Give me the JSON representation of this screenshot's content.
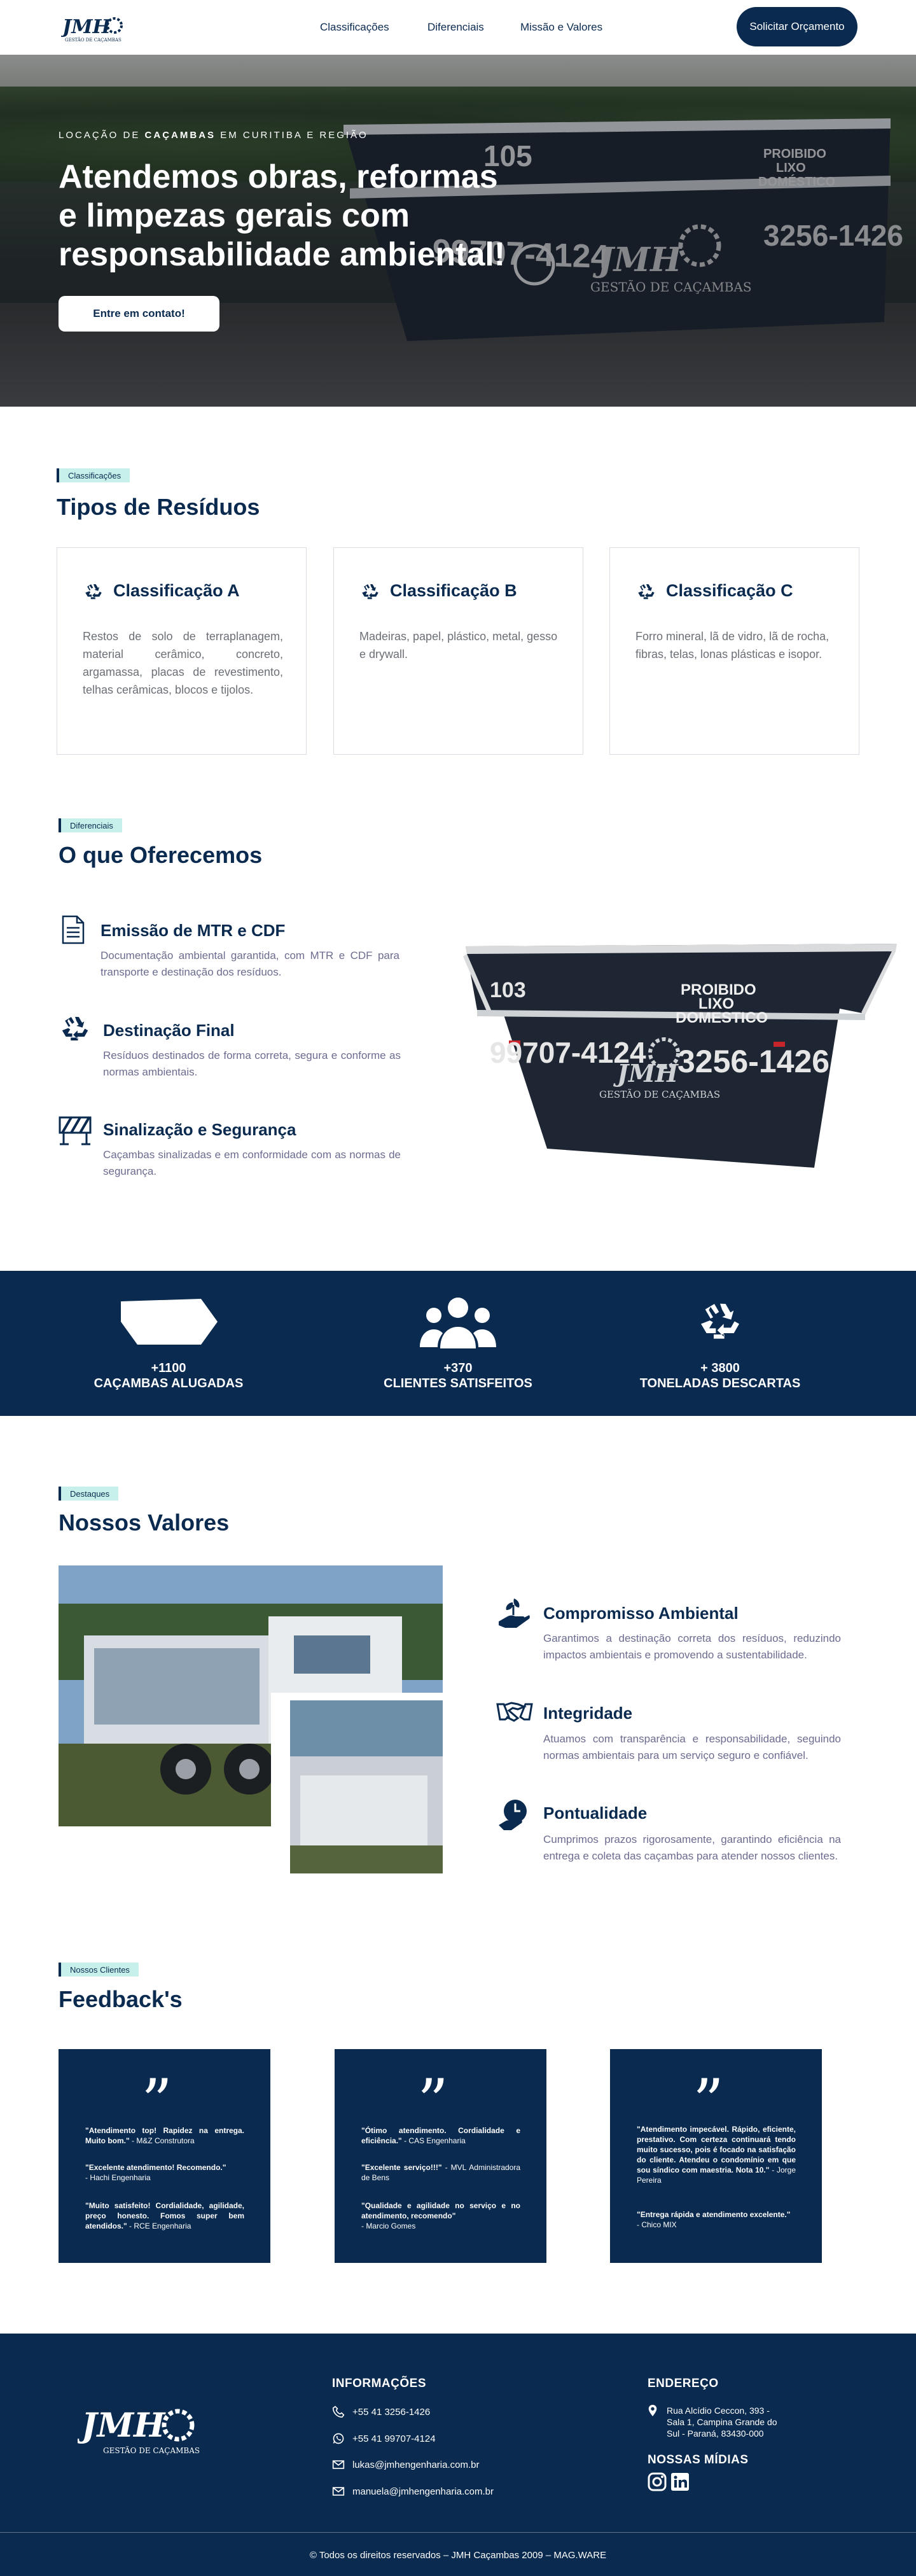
{
  "header": {
    "logo": "JMH",
    "logo_sub": "GESTÃO DE CAÇAMBAS",
    "nav": [
      "Classificações",
      "Diferenciais",
      "Missão e Valores"
    ],
    "cta": "Solicitar Orçamento"
  },
  "hero": {
    "kicker_pre": "LOCAÇÃO DE ",
    "kicker_bold": "CAÇAMBAS",
    "kicker_post": " EM CURITIBA E REGIÃO",
    "title_line1": "Atendemos obras, reformas",
    "title_line2": "e limpezas gerais com",
    "title_line3": "responsabilidade ambiental!",
    "button": "Entre em contato!",
    "bin_number": "105",
    "bin_text": [
      "PROIBIDO",
      "LIXO",
      "DOMÉSTICO"
    ],
    "bin_phone1": "99707-4124",
    "bin_phone2": "3256-1426"
  },
  "classificacoes": {
    "tag": "Classificações",
    "title": "Tipos de Resíduos",
    "cards": [
      {
        "title": "Classificação A",
        "text": "Restos de solo de terraplanagem, material cerâmico, concreto, argamassa, placas de revestimento, telhas cerâmicas, blocos e tijolos."
      },
      {
        "title": "Classificação B",
        "text": "Madeiras, papel, plástico, metal, gesso e drywall."
      },
      {
        "title": "Classificação C",
        "text": "Forro mineral, lã de vidro, lã de rocha, fibras, telas, lonas plásticas e isopor."
      }
    ]
  },
  "diferenciais": {
    "tag": "Diferenciais",
    "title": "O que Oferecemos",
    "items": [
      {
        "title": "Emissão de MTR e CDF",
        "text": "Documentação ambiental garantida, com MTR e CDF para transporte e destinação dos resíduos.",
        "icon": "document-icon"
      },
      {
        "title": "Destinação Final",
        "text": "Resíduos destinados de forma correta, segura e conforme as normas ambientais.",
        "icon": "recycle-icon"
      },
      {
        "title": "Sinalização e Segurança",
        "text": "Caçambas sinalizadas e em conformidade com as normas de segurança.",
        "icon": "barrier-icon"
      }
    ],
    "bin": {
      "number": "103",
      "text": [
        "PROIBIDO",
        "LIXO",
        "DOMESTICO"
      ],
      "phone1": "99707-4124",
      "phone2": "3256-1426",
      "logo": "JMH",
      "logo_sub": "GESTÃO DE CAÇAMBAS"
    }
  },
  "stats": [
    {
      "num": "+1100",
      "label": "CAÇAMBAS ALUGADAS",
      "icon": "container-icon"
    },
    {
      "num": "+370",
      "label": "CLIENTES SATISFEITOS",
      "icon": "people-icon"
    },
    {
      "num": "+ 3800",
      "label": "TONELADAS DESCARTAS",
      "icon": "recycle-icon"
    }
  ],
  "valores": {
    "tag": "Destaques",
    "title": "Nossos Valores",
    "items": [
      {
        "title": "Compromisso Ambiental",
        "text": "Garantimos a destinação correta dos resíduos, reduzindo impactos ambientais e promovendo a sustentabilidade.",
        "icon": "plant-hand-icon"
      },
      {
        "title": "Integridade",
        "text": "Atuamos com transparência e responsabilidade, seguindo normas ambientais para um serviço seguro e confiável.",
        "icon": "handshake-icon"
      },
      {
        "title": "Pontualidade",
        "text": "Cumprimos prazos rigorosamente, garantindo eficiência na entrega e coleta das caçambas para atender nossos clientes.",
        "icon": "clock-icon"
      }
    ]
  },
  "feedback": {
    "tag": "Nossos Clientes",
    "title": "Feedback's",
    "cards": [
      [
        {
          "quote": "\"Atendimento top! Rapidez na entrega. Muito bom.\"",
          "author": " - M&Z Construtora"
        },
        {
          "quote": "\"Excelente atendimento! Recomendo.\"",
          "author": " - Hachi Engenharia"
        },
        {
          "quote": "\"Muito satisfeito! Cordialidade, agilidade, preço honesto. Fomos super bem atendidos.\"",
          "author": " - RCE Engenharia"
        }
      ],
      [
        {
          "quote": "\"Ótimo atendimento. Cordialidade e eficiência.\"",
          "author": " - CAS Engenharia"
        },
        {
          "quote": "\"Excelente serviço!!!\"",
          "author": " - MVL Administradora de Bens"
        },
        {
          "quote": "\"Qualidade e agilidade no serviço e no atendimento, recomendo\"",
          "author": " - Marcio Gomes"
        }
      ],
      [
        {
          "quote": "\"Atendimento impecável. Rápido, eficiente, prestativo. Com certeza continuará tendo muito sucesso, pois é focado na satisfação do cliente. Atendeu o condomínio em que sou síndico com maestria. Nota 10.\"",
          "author": " - Jorge Pereira"
        },
        {
          "quote": "\"Entrega rápida e atendimento excelente.\"",
          "author": " - Chico MIX"
        }
      ]
    ]
  },
  "footer": {
    "logo": "JMH",
    "logo_sub": "GESTÃO DE CAÇAMBAS",
    "info_title": "INFORMAÇÕES",
    "phone": "+55 41 3256-1426",
    "whatsapp": "+55 41 99707-4124",
    "email1": "lukas@jmhengenharia.com.br",
    "email2": "manuela@jmhengenharia.com.br",
    "address_title": "ENDEREÇO",
    "address": [
      "Rua Alcídio Ceccon, 393 -",
      "Sala 1, Campina Grande do",
      "Sul - Paraná, 83430-000"
    ],
    "social_title": "NOSSAS MÍDIAS",
    "copyright": "© Todos os direitos reservados – JMH Caçambas 2009 –  MAG.WARE"
  }
}
